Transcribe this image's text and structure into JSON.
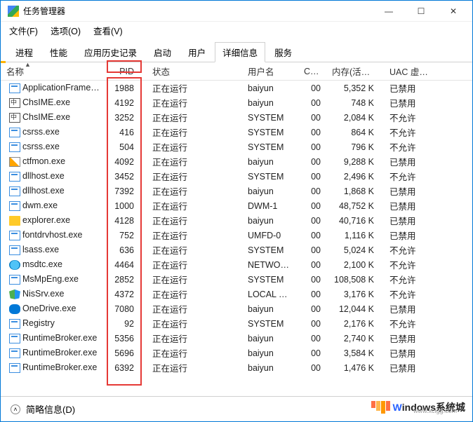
{
  "window": {
    "title": "任务管理器"
  },
  "menu": {
    "file": "文件(F)",
    "options": "选项(O)",
    "view": "查看(V)"
  },
  "tabs": {
    "items": [
      "进程",
      "性能",
      "应用历史记录",
      "启动",
      "用户",
      "详细信息",
      "服务"
    ],
    "active_index": 5
  },
  "columns": {
    "name": "名称",
    "pid": "PID",
    "state": "状态",
    "user": "用户名",
    "cpu": "CPU",
    "mem": "内存(活动...",
    "uac": "UAC 虚拟化"
  },
  "rows": [
    {
      "icon": "default",
      "name": "ApplicationFrameH...",
      "pid": "1988",
      "state": "正在运行",
      "user": "baiyun",
      "cpu": "00",
      "mem": "5,352 K",
      "uac": "已禁用"
    },
    {
      "icon": "ime",
      "name": "ChsIME.exe",
      "pid": "4192",
      "state": "正在运行",
      "user": "baiyun",
      "cpu": "00",
      "mem": "748 K",
      "uac": "已禁用"
    },
    {
      "icon": "ime",
      "name": "ChsIME.exe",
      "pid": "3252",
      "state": "正在运行",
      "user": "SYSTEM",
      "cpu": "00",
      "mem": "2,084 K",
      "uac": "不允许"
    },
    {
      "icon": "default",
      "name": "csrss.exe",
      "pid": "416",
      "state": "正在运行",
      "user": "SYSTEM",
      "cpu": "00",
      "mem": "864 K",
      "uac": "不允许"
    },
    {
      "icon": "default",
      "name": "csrss.exe",
      "pid": "504",
      "state": "正在运行",
      "user": "SYSTEM",
      "cpu": "00",
      "mem": "796 K",
      "uac": "不允许"
    },
    {
      "icon": "pen",
      "name": "ctfmon.exe",
      "pid": "4092",
      "state": "正在运行",
      "user": "baiyun",
      "cpu": "00",
      "mem": "9,288 K",
      "uac": "已禁用"
    },
    {
      "icon": "default",
      "name": "dllhost.exe",
      "pid": "3452",
      "state": "正在运行",
      "user": "SYSTEM",
      "cpu": "00",
      "mem": "2,496 K",
      "uac": "不允许"
    },
    {
      "icon": "default",
      "name": "dllhost.exe",
      "pid": "7392",
      "state": "正在运行",
      "user": "baiyun",
      "cpu": "00",
      "mem": "1,868 K",
      "uac": "已禁用"
    },
    {
      "icon": "default",
      "name": "dwm.exe",
      "pid": "1000",
      "state": "正在运行",
      "user": "DWM-1",
      "cpu": "00",
      "mem": "48,752 K",
      "uac": "已禁用"
    },
    {
      "icon": "explorer",
      "name": "explorer.exe",
      "pid": "4128",
      "state": "正在运行",
      "user": "baiyun",
      "cpu": "00",
      "mem": "40,716 K",
      "uac": "已禁用"
    },
    {
      "icon": "default",
      "name": "fontdrvhost.exe",
      "pid": "752",
      "state": "正在运行",
      "user": "UMFD-0",
      "cpu": "00",
      "mem": "1,116 K",
      "uac": "已禁用"
    },
    {
      "icon": "default",
      "name": "lsass.exe",
      "pid": "636",
      "state": "正在运行",
      "user": "SYSTEM",
      "cpu": "00",
      "mem": "5,024 K",
      "uac": "不允许"
    },
    {
      "icon": "net",
      "name": "msdtc.exe",
      "pid": "4464",
      "state": "正在运行",
      "user": "NETWOR...",
      "cpu": "00",
      "mem": "2,100 K",
      "uac": "不允许"
    },
    {
      "icon": "default",
      "name": "MsMpEng.exe",
      "pid": "2852",
      "state": "正在运行",
      "user": "SYSTEM",
      "cpu": "00",
      "mem": "108,508 K",
      "uac": "不允许"
    },
    {
      "icon": "shield",
      "name": "NisSrv.exe",
      "pid": "4372",
      "state": "正在运行",
      "user": "LOCAL SE...",
      "cpu": "00",
      "mem": "3,176 K",
      "uac": "不允许"
    },
    {
      "icon": "cloud",
      "name": "OneDrive.exe",
      "pid": "7080",
      "state": "正在运行",
      "user": "baiyun",
      "cpu": "00",
      "mem": "12,044 K",
      "uac": "已禁用"
    },
    {
      "icon": "default",
      "name": "Registry",
      "pid": "92",
      "state": "正在运行",
      "user": "SYSTEM",
      "cpu": "00",
      "mem": "2,176 K",
      "uac": "不允许"
    },
    {
      "icon": "default",
      "name": "RuntimeBroker.exe",
      "pid": "5356",
      "state": "正在运行",
      "user": "baiyun",
      "cpu": "00",
      "mem": "2,740 K",
      "uac": "已禁用"
    },
    {
      "icon": "default",
      "name": "RuntimeBroker.exe",
      "pid": "5696",
      "state": "正在运行",
      "user": "baiyun",
      "cpu": "00",
      "mem": "3,584 K",
      "uac": "已禁用"
    },
    {
      "icon": "default",
      "name": "RuntimeBroker.exe",
      "pid": "6392",
      "state": "正在运行",
      "user": "baiyun",
      "cpu": "00",
      "mem": "1,476 K",
      "uac": "已禁用"
    }
  ],
  "footer": {
    "brief": "简略信息(D)"
  },
  "watermark": {
    "brand_a": "W",
    "brand_b": "indows",
    "brand_c": "系统城",
    "sub": "www.xclgg.com"
  },
  "win_btns": {
    "min": "—",
    "max": "☐",
    "close": "✕"
  }
}
